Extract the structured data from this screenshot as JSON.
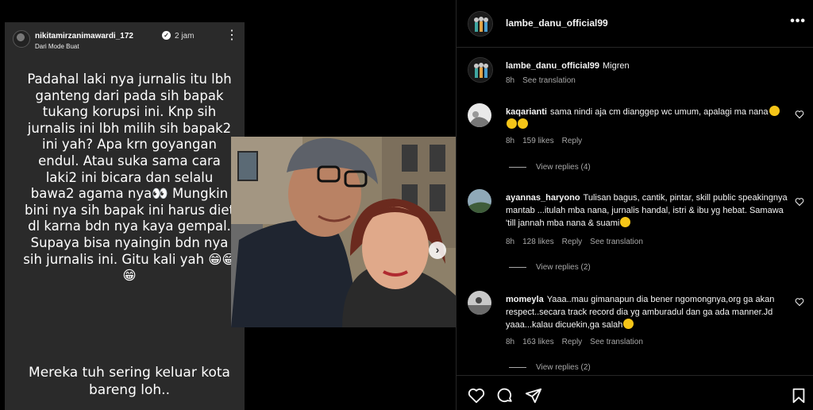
{
  "story": {
    "username": "nikitamirzanimawardi_172",
    "time": "2 jam",
    "subtitle": "Dari Mode Buat",
    "text_main": "Padahal laki nya jurnalis itu lbh ganteng dari pada sih bapak tukang korupsi ini. Knp sih jurnalis ini lbh milih sih bapak2 ini yah? Apa krn goyangan endul. Atau suka sama cara laki2 ini bicara dan selalu bawa2 agama nya👀 Mungkin bini nya sih bapak ini harus diet dl karna bdn nya kaya gempal. Supaya bisa nyaingin bdn nya sih jurnalis ini. Gitu kali yah 😁😁😁",
    "text_bottom": "Mereka tuh sering keluar kota bareng loh.."
  },
  "post": {
    "username": "lambe_danu_official99",
    "more_icon": "more-horizontal-icon"
  },
  "caption": {
    "username": "lambe_danu_official99",
    "text": "Migren",
    "time": "8h",
    "see_translation": "See translation"
  },
  "comments": [
    {
      "username": "kaqarianti",
      "text": "sama nindi aja cm dianggep wc umum, apalagi ma nana",
      "time": "8h",
      "likes": "159 likes",
      "reply": "Reply",
      "view_replies": "View replies (4)"
    },
    {
      "username": "ayannas_haryono",
      "text": "Tulisan bagus, cantik, pintar, skill public speakingnya mantab ...itulah mba nana, jurnalis handal, istri & ibu yg hebat. Samawa 'till jannah mba nana & suami",
      "time": "8h",
      "likes": "128 likes",
      "reply": "Reply",
      "see_translation": "See translation",
      "view_replies": "View replies (2)"
    },
    {
      "username": "momeyla",
      "text": "Yaaa..mau gimanapun dia bener ngomongnya,org ga akan respect..secara track record dia yg amburadul dan ga ada manner.Jd yaaa...kalau dicuekin,ga salah",
      "time": "8h",
      "likes": "163 likes",
      "reply": "Reply",
      "see_translation": "See translation",
      "view_replies": "View replies (2)"
    }
  ],
  "colors": {
    "background": "#000000",
    "text": "#f5f5f5",
    "secondary": "#a8a8a8",
    "story_bg": "#2a2a2a",
    "border": "#262626"
  }
}
